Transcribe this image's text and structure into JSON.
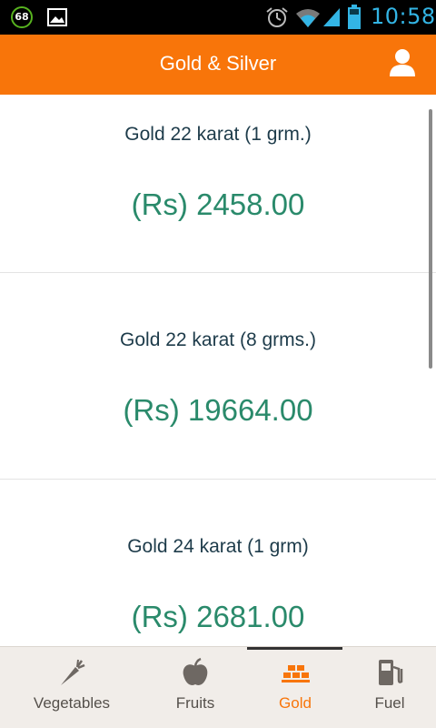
{
  "status_bar": {
    "battery_level": "68",
    "time": "10:58",
    "icons": [
      "battery-level-badge-icon",
      "image-notification-icon",
      "alarm-icon",
      "wifi-icon",
      "signal-icon",
      "battery-icon"
    ]
  },
  "app_bar": {
    "title": "Gold & Silver",
    "profile_icon": "user-icon"
  },
  "prices": [
    {
      "label": "Gold 22 karat (1 grm.)",
      "price": "(Rs) 2458.00"
    },
    {
      "label": "Gold 22 karat (8 grms.)",
      "price": "(Rs) 19664.00"
    },
    {
      "label": "Gold 24 karat (1 grm)",
      "price": "(Rs) 2681.00"
    }
  ],
  "bottom_nav": {
    "active": "Gold",
    "items": [
      {
        "label": "Vegetables",
        "icon": "carrot-icon"
      },
      {
        "label": "Fruits",
        "icon": "apple-icon"
      },
      {
        "label": "Gold",
        "icon": "gold-bars-icon"
      },
      {
        "label": "Fuel",
        "icon": "fuel-pump-icon"
      }
    ]
  },
  "colors": {
    "accent": "#f8750a",
    "price_text": "#2a8a6b",
    "label_text": "#1d3b4a",
    "time_text": "#33b5e5"
  }
}
